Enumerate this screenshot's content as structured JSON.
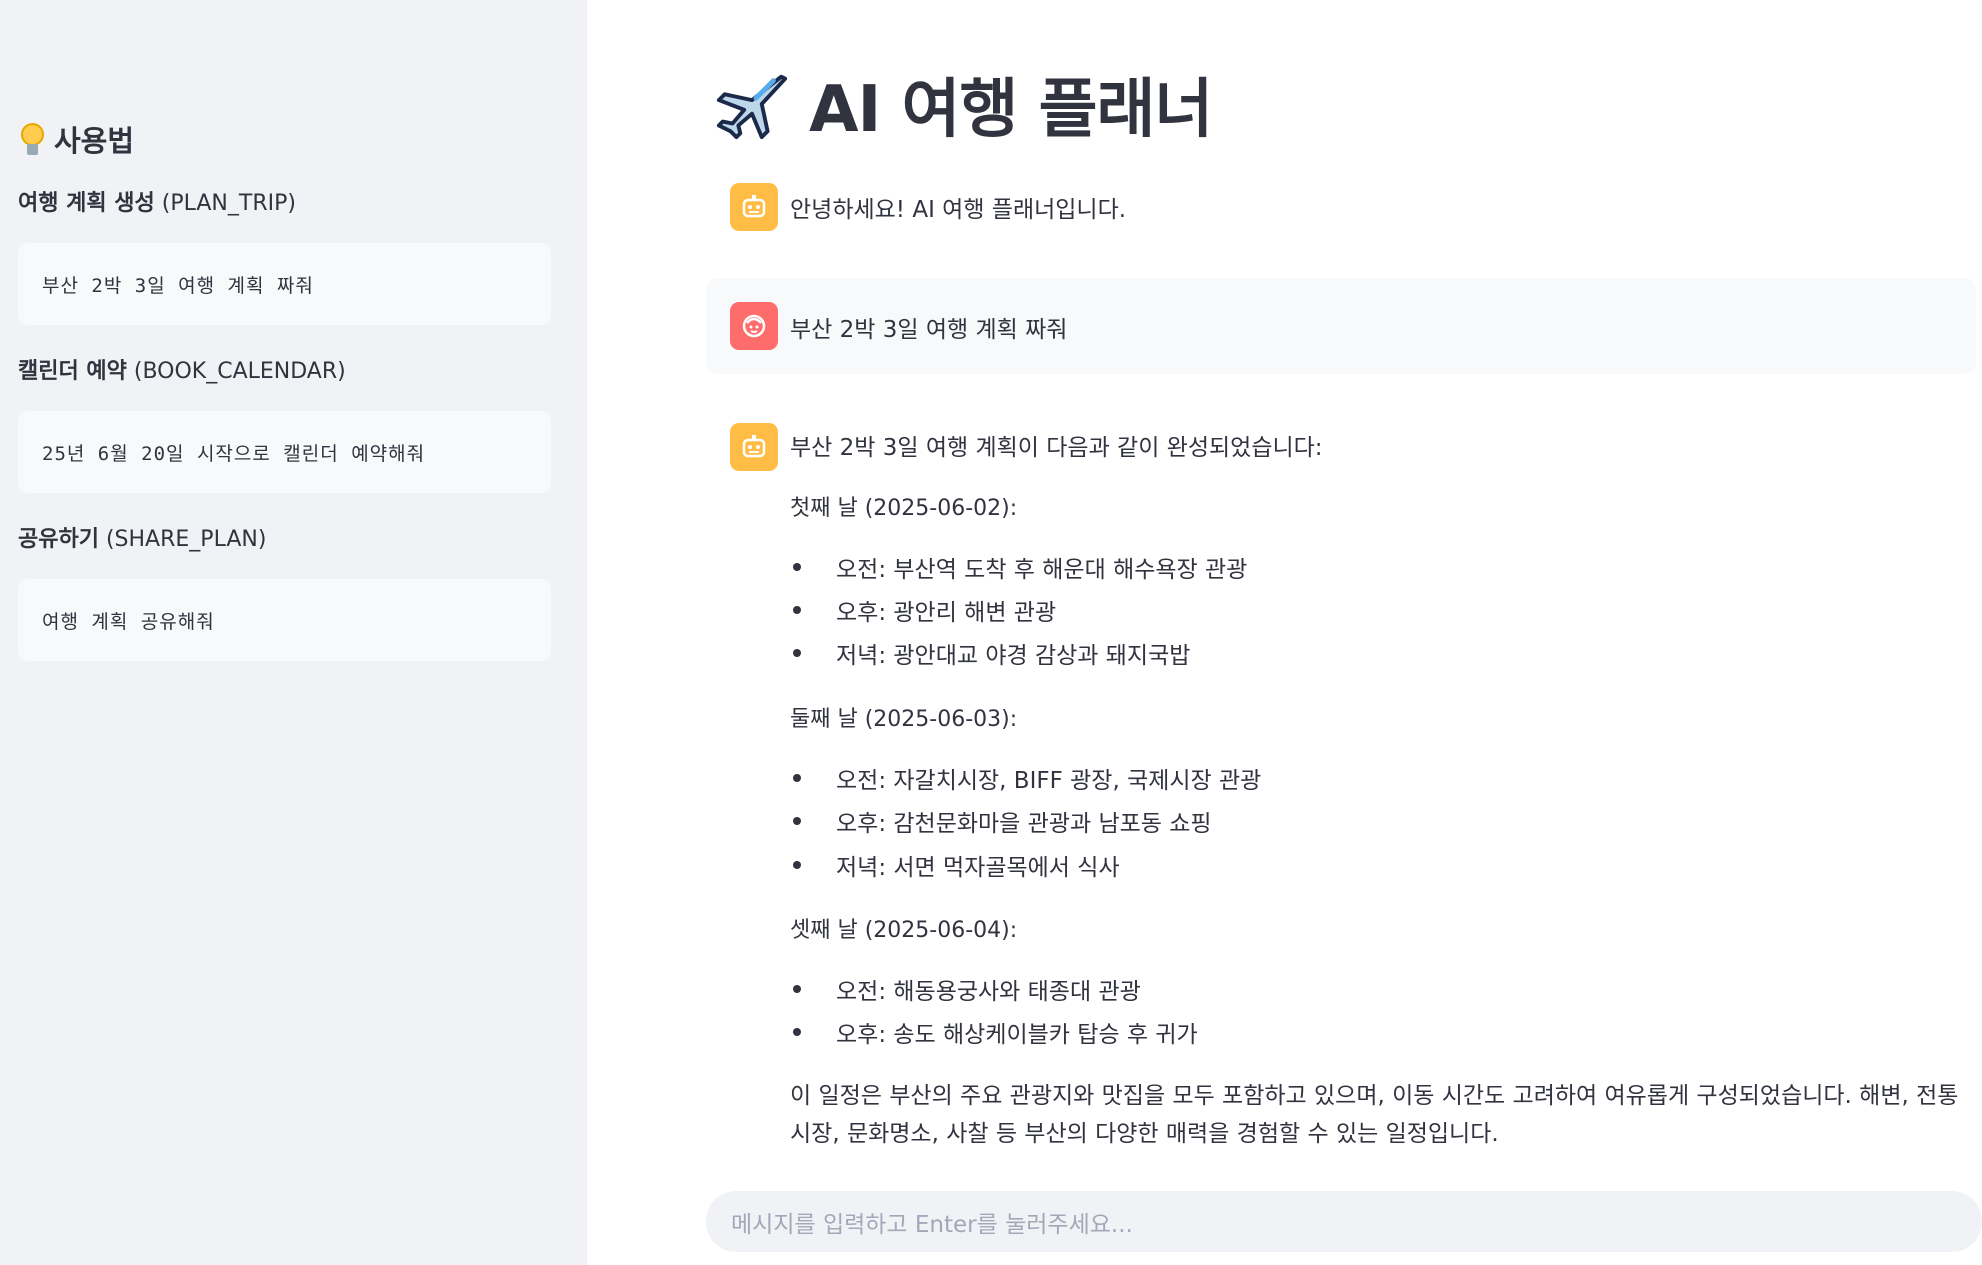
{
  "sidebar": {
    "heading": "사용법",
    "commands": [
      {
        "label": "여행 계획 생성",
        "code": "(PLAN_TRIP)",
        "example": "부산 2박 3일 여행 계획 짜줘"
      },
      {
        "label": "캘린더 예약",
        "code": "(BOOK_CALENDAR)",
        "example": "25년 6월 20일 시작으로 캘린더 예약해줘"
      },
      {
        "label": "공유하기",
        "code": "(SHARE_PLAN)",
        "example": "여행 계획 공유해줘"
      }
    ]
  },
  "main": {
    "title": "AI 여행 플래너",
    "messages": [
      {
        "role": "assistant",
        "text": "안녕하세요! AI 여행 플래너입니다."
      },
      {
        "role": "user",
        "text": "부산 2박 3일 여행 계획 짜줘"
      },
      {
        "role": "assistant",
        "text": "부산 2박 3일 여행 계획이 다음과 같이 완성되었습니다:"
      }
    ],
    "plan": [
      {
        "day": "첫째 날 (2025-06-02):",
        "items": [
          "오전: 부산역 도착 후 해운대 해수욕장 관광",
          "오후: 광안리 해변 관광",
          "저녁: 광안대교 야경 감상과 돼지국밥"
        ]
      },
      {
        "day": "둘째 날 (2025-06-03):",
        "items": [
          "오전: 자갈치시장, BIFF 광장, 국제시장 관광",
          "오후: 감천문화마을 관광과 남포동 쇼핑",
          "저녁: 서면 먹자골목에서 식사"
        ]
      },
      {
        "day": "셋째 날 (2025-06-04):",
        "items": [
          "오전: 해동용궁사와 태종대 관광",
          "오후: 송도 해상케이블카 탑승 후 귀가"
        ]
      }
    ],
    "summary": "이 일정은 부산의 주요 관광지와 맛집을 모두 포함하고 있으며, 이동 시간도 고려하여 여유롭게 구성되었습니다. 해변, 전통시장, 문화명소, 사찰 등 부산의 다양한 매력을 경험할 수 있는 일정입니다."
  },
  "chat_input": {
    "placeholder": "메시지를 입력하고 Enter를 눌러주세요..."
  },
  "colors": {
    "sidebar_bg": "#f0f2f6",
    "bot_avatar": "#ffbd45",
    "user_avatar": "#ff6c6c",
    "text": "#31333f"
  }
}
